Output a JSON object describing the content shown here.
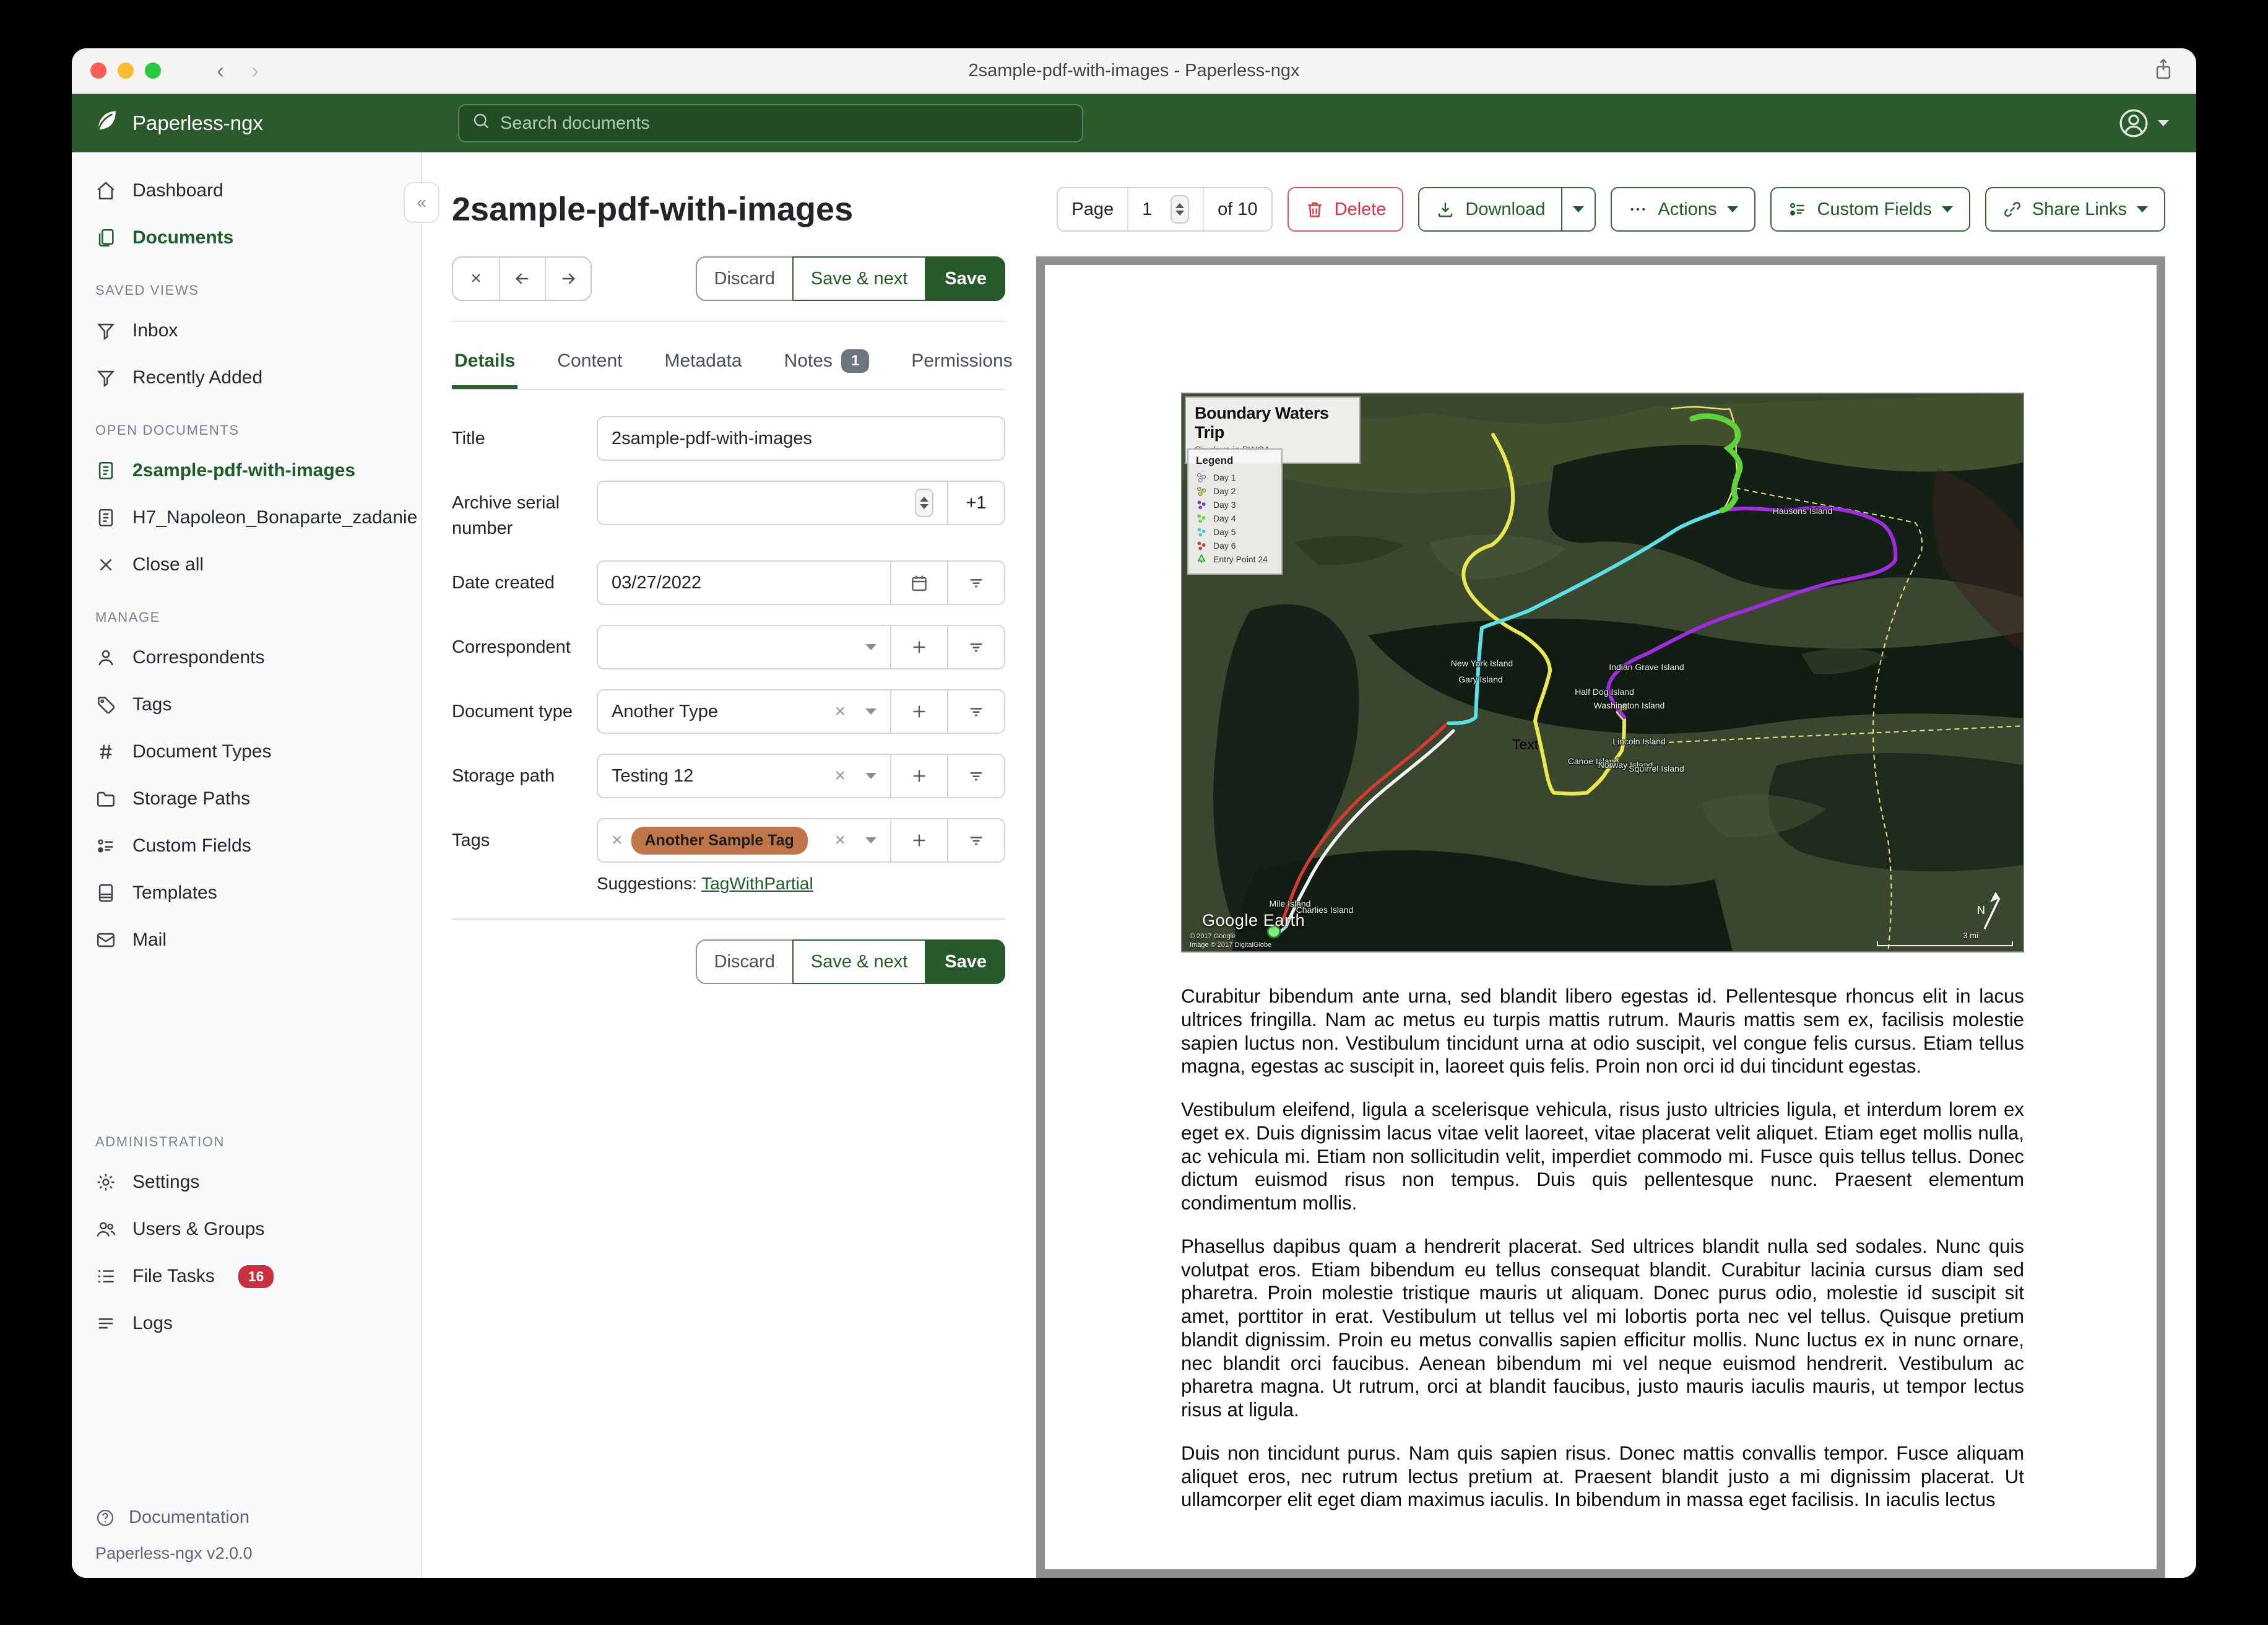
{
  "titlebar": {
    "title": "2sample-pdf-with-images - Paperless-ngx"
  },
  "navbar": {
    "brand": "Paperless-ngx",
    "search_placeholder": "Search documents"
  },
  "sidebar": {
    "primary": [
      {
        "label": "Dashboard"
      },
      {
        "label": "Documents"
      }
    ],
    "saved_views": {
      "heading": "SAVED VIEWS",
      "items": [
        {
          "label": "Inbox"
        },
        {
          "label": "Recently Added"
        }
      ]
    },
    "open_documents": {
      "heading": "OPEN DOCUMENTS",
      "items": [
        {
          "label": "2sample-pdf-with-images"
        },
        {
          "label": "H7_Napoleon_Bonaparte_zadanie"
        },
        {
          "label": "Close all"
        }
      ]
    },
    "manage": {
      "heading": "MANAGE",
      "items": [
        {
          "label": "Correspondents"
        },
        {
          "label": "Tags"
        },
        {
          "label": "Document Types"
        },
        {
          "label": "Storage Paths"
        },
        {
          "label": "Custom Fields"
        },
        {
          "label": "Templates"
        },
        {
          "label": "Mail"
        }
      ]
    },
    "administration": {
      "heading": "ADMINISTRATION",
      "items": [
        {
          "label": "Settings"
        },
        {
          "label": "Users & Groups"
        },
        {
          "label": "File Tasks",
          "badge": "16"
        },
        {
          "label": "Logs"
        }
      ]
    },
    "footer": {
      "documentation": "Documentation",
      "version": "Paperless-ngx v2.0.0"
    }
  },
  "doc_header": {
    "title": "2sample-pdf-with-images",
    "page": {
      "label": "Page",
      "value": "1",
      "of": "of 10"
    },
    "buttons": {
      "delete": "Delete",
      "download": "Download",
      "actions": "Actions",
      "custom_fields": "Custom Fields",
      "share_links": "Share Links"
    }
  },
  "editor": {
    "actions": {
      "discard": "Discard",
      "save_next": "Save & next",
      "save": "Save"
    },
    "tabs": [
      {
        "label": "Details"
      },
      {
        "label": "Content"
      },
      {
        "label": "Metadata"
      },
      {
        "label": "Notes",
        "badge": "1"
      },
      {
        "label": "Permissions"
      }
    ],
    "fields": {
      "title": {
        "label": "Title",
        "value": "2sample-pdf-with-images"
      },
      "asn": {
        "label": "Archive serial number",
        "value": "",
        "add_one": "+1"
      },
      "date_created": {
        "label": "Date created",
        "value": "03/27/2022"
      },
      "correspondent": {
        "label": "Correspondent",
        "value": ""
      },
      "document_type": {
        "label": "Document type",
        "value": "Another Type"
      },
      "storage_path": {
        "label": "Storage path",
        "value": "Testing 12"
      },
      "tags": {
        "label": "Tags",
        "chip": "Another Sample Tag",
        "chip_color": "#c1764a",
        "suggestions_label": "Suggestions:",
        "suggestion": "TagWithPartial"
      }
    }
  },
  "preview": {
    "map": {
      "title": "Boundary Waters Trip",
      "subtitle": "Six days in BWCA",
      "legend_title": "Legend",
      "legend": [
        {
          "label": "Day 1",
          "color": "#d8e4ee"
        },
        {
          "label": "Day 2",
          "color": "#d6d64e"
        },
        {
          "label": "Day 3",
          "color": "#8437c9"
        },
        {
          "label": "Day 4",
          "color": "#6fd43e"
        },
        {
          "label": "Day 5",
          "color": "#49c8d8"
        },
        {
          "label": "Day 6",
          "color": "#cf3b45"
        },
        {
          "label": "Entry Point 24",
          "color": "#59c94f"
        }
      ],
      "islands": [
        "New York Island",
        "Gary Island",
        "Hausons Island",
        "Indian Grave Island",
        "Half Dog Island",
        "Washington Island",
        "Lincoln Island",
        "Canoe Island",
        "Norway Island",
        "Squirrel Island",
        "Mile Island",
        "Charlies Island"
      ],
      "text_label": "Text",
      "watermark": "Google Earth",
      "credit1": "© 2017 Google",
      "credit2": "Image © 2017 DigitalGlobe",
      "scale": "3 mi",
      "compass": "N"
    },
    "paragraphs": [
      "Curabitur bibendum ante urna, sed blandit libero egestas id. Pellentesque rhoncus elit in lacus ultrices fringilla. Nam ac metus eu turpis mattis rutrum. Mauris mattis sem ex, facilisis molestie sapien luctus non. Vestibulum tincidunt urna at odio suscipit, vel congue felis cursus. Etiam tellus magna, egestas ac suscipit in, laoreet quis felis. Proin non orci id dui tincidunt egestas.",
      "Vestibulum eleifend, ligula a scelerisque vehicula, risus justo ultricies ligula, et interdum lorem ex eget ex. Duis dignissim lacus vitae velit laoreet, vitae placerat velit aliquet. Etiam eget mollis nulla, ac vehicula mi. Etiam non sollicitudin velit, imperdiet commodo mi. Fusce quis tellus tellus. Donec dictum euismod risus non tempus. Duis quis pellentesque nunc. Praesent elementum condimentum mollis.",
      "Phasellus dapibus quam a hendrerit placerat. Sed ultrices blandit nulla sed sodales. Nunc quis volutpat eros. Etiam bibendum eu tellus consequat blandit. Curabitur lacinia cursus diam sed pharetra. Proin molestie tristique mauris ut aliquam. Donec purus odio, molestie id suscipit sit amet, porttitor in erat. Vestibulum ut tellus vel mi lobortis porta nec vel tellus. Quisque pretium blandit dignissim. Proin eu metus convallis sapien efficitur mollis. Nunc luctus ex in nunc ornare, nec blandit orci faucibus. Aenean bibendum mi vel neque euismod hendrerit. Vestibulum ac pharetra magna. Ut rutrum, orci at blandit faucibus, justo mauris iaculis mauris, ut tempor lectus risus at ligula.",
      "Duis non tincidunt purus. Nam quis sapien risus. Donec mattis convallis tempor. Fusce aliquam aliquet eros, nec rutrum lectus pretium at. Praesent blandit justo a mi dignissim placerat. Ut ullamcorper elit eget diam maximus iaculis. In bibendum in massa eget facilisis. In iaculis lectus"
    ]
  },
  "colors": {
    "navbar_green": "#2b5a2d",
    "accent_green": "#1f5c28",
    "danger_red": "#dc3545",
    "tag_chip": "#c1764a"
  }
}
